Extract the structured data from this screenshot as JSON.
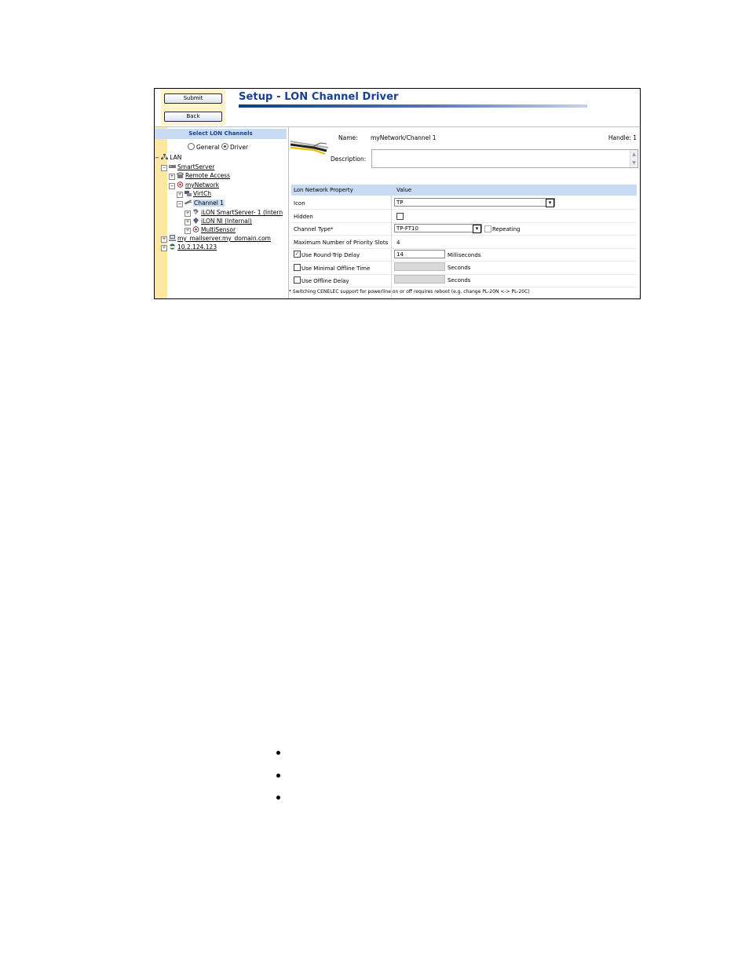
{
  "toolbar": {
    "submit_label": "Submit",
    "back_label": "Back"
  },
  "page": {
    "title": "Setup - LON Channel Driver"
  },
  "tree_panel": {
    "header": "Select LON Channels",
    "mode_general_label": "General",
    "mode_driver_label": "Driver",
    "mode_selected": "Driver",
    "nodes": [
      {
        "expander": "−",
        "label": "LAN",
        "selected": false
      },
      {
        "expander": "−",
        "label": "SmartServer",
        "selected": false
      },
      {
        "expander": "+",
        "label": "Remote Access",
        "selected": false
      },
      {
        "expander": "−",
        "label": "myNetwork",
        "selected": false
      },
      {
        "expander": "+",
        "label": "VirtCh",
        "selected": false
      },
      {
        "expander": "−",
        "label": "Channel 1",
        "selected": true
      },
      {
        "expander": "+",
        "label": "iLON SmartServer- 1 (Intern",
        "selected": false
      },
      {
        "expander": "+",
        "label": "iLON NI (Internal)",
        "selected": false
      },
      {
        "expander": "+",
        "label": "MultiSensor",
        "selected": false
      },
      {
        "expander": "+",
        "label": "my_mailserver.my_domain.com",
        "selected": false
      },
      {
        "expander": "+",
        "label": "10.2.124.123",
        "selected": false
      }
    ]
  },
  "details": {
    "name_label": "Name:",
    "name_value": "myNetwork/Channel 1",
    "handle_text": "Handle: 1",
    "description_label": "Description:",
    "description_value": "",
    "grid": {
      "col_property": "Lon Network Property",
      "col_value": "Value",
      "icon_label": "Icon",
      "icon_value": "TP",
      "hidden_label": "Hidden",
      "hidden_checked": false,
      "channel_type_label": "Channel Type*",
      "channel_type_value": "TP-FT10",
      "repeating_label": "Repeating",
      "repeating_checked": false,
      "priority_slots_label": "Maximum Number of Priority Slots",
      "priority_slots_value": "4",
      "round_trip_label": "Use Round-Trip Delay",
      "round_trip_checked": true,
      "round_trip_value": "14",
      "round_trip_unit": "Milliseconds",
      "min_offline_label": "Use Minimal Offline Time",
      "min_offline_checked": false,
      "min_offline_value": "",
      "min_offline_unit": "Seconds",
      "offline_delay_label": "Use Offline Delay",
      "offline_delay_checked": false,
      "offline_delay_value": "",
      "offline_delay_unit": "Seconds"
    },
    "footnote": "* Switching CENELEC support for powerline on or off requires reboot (e.g. change PL-20N <-> PL-20C)"
  },
  "colors": {
    "title": "#1b3f8f",
    "header_bg": "#c7dcf4",
    "tree_strip": "#fde7a3",
    "button_panel": "#fff3cc"
  },
  "icons": [
    "lan-icon",
    "server-icon",
    "phone-icon",
    "network-icon",
    "channel-icon",
    "device-icon",
    "cable-icon"
  ]
}
